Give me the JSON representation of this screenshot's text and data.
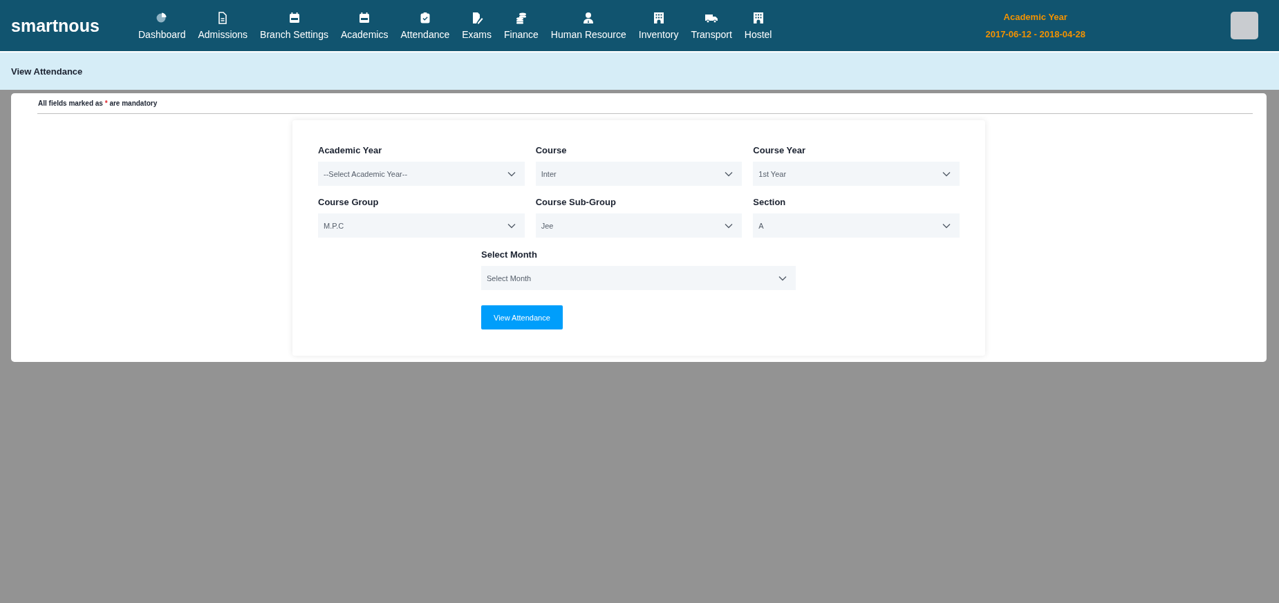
{
  "brand": "smartnous",
  "nav": [
    {
      "label": "Dashboard"
    },
    {
      "label": "Admissions"
    },
    {
      "label": "Branch Settings"
    },
    {
      "label": "Academics"
    },
    {
      "label": "Attendance"
    },
    {
      "label": "Exams"
    },
    {
      "label": "Finance"
    },
    {
      "label": "Human Resource"
    },
    {
      "label": "Inventory"
    },
    {
      "label": "Transport"
    },
    {
      "label": "Hostel"
    }
  ],
  "academic_year": {
    "label": "Academic Year",
    "range": "2017-06-12 - 2018-04-28"
  },
  "page_title": "View Attendance",
  "note": {
    "before": "All fields marked as",
    "mark": "*",
    "after": "are mandatory"
  },
  "fields": [
    {
      "label": "Academic Year",
      "value": "--Select Academic Year--"
    },
    {
      "label": "Course",
      "value": "Inter"
    },
    {
      "label": "Course Year",
      "value": "1st Year"
    },
    {
      "label": "Course Group",
      "value": "M.P.C"
    },
    {
      "label": "Course Sub-Group",
      "value": "Jee"
    },
    {
      "label": "Section",
      "value": "A"
    }
  ],
  "month_field": {
    "label": "Select Month",
    "value": "Select Month"
  },
  "submit": "View Attendance"
}
